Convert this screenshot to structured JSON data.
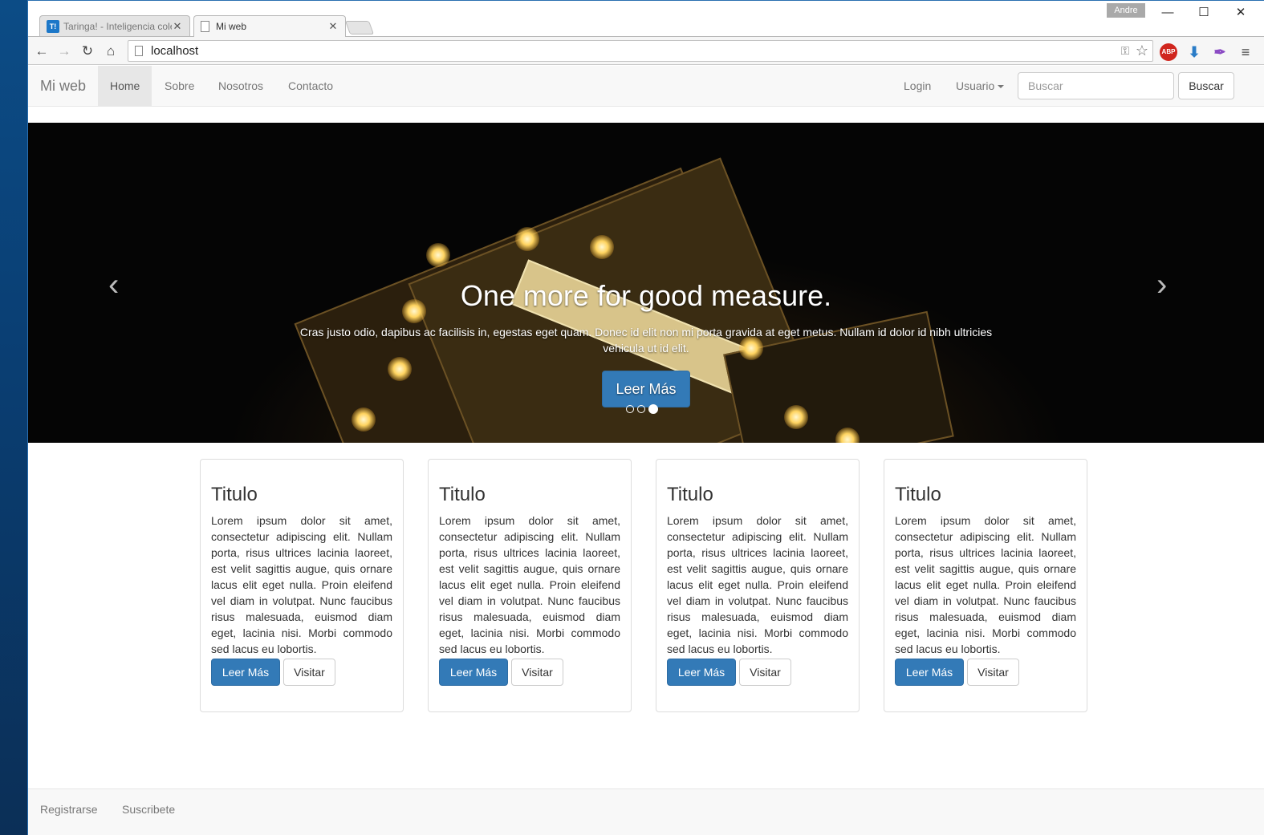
{
  "browser": {
    "tabs": [
      {
        "label": "Taringa! - Inteligencia cole",
        "favicon": "taringa-icon",
        "active": false
      },
      {
        "label": "Mi web",
        "favicon": "page-icon",
        "active": true
      }
    ],
    "profile": "Andre",
    "url": "localhost",
    "extensions": {
      "abp": "ABP"
    }
  },
  "navbar": {
    "brand": "Mi web",
    "items": [
      {
        "label": "Home",
        "active": true
      },
      {
        "label": "Sobre",
        "active": false
      },
      {
        "label": "Nosotros",
        "active": false
      },
      {
        "label": "Contacto",
        "active": false
      }
    ],
    "login": "Login",
    "user_menu": "Usuario",
    "search_placeholder": "Buscar",
    "search_button": "Buscar"
  },
  "carousel": {
    "heading": "One more for good measure.",
    "text": "Cras justo odio, dapibus ac facilisis in, egestas eget quam. Donec id elit non mi porta gravida at eget metus. Nullam id dolor id nibh ultricies vehicula ut id elit.",
    "button": "Leer Más",
    "slide_count": 3,
    "active_slide": 3
  },
  "cards": [
    {
      "title": "Titulo",
      "text": "Lorem ipsum dolor sit amet, consectetur adipiscing elit. Nullam porta, risus ultrices lacinia laoreet, est velit sagittis augue, quis ornare lacus elit eget nulla. Proin eleifend vel diam in volutpat. Nunc faucibus risus malesuada, euismod diam eget, lacinia nisi. Morbi commodo sed lacus eu lobortis.",
      "primary": "Leer Más",
      "secondary": "Visitar"
    },
    {
      "title": "Titulo",
      "text": "Lorem ipsum dolor sit amet, consectetur adipiscing elit. Nullam porta, risus ultrices lacinia laoreet, est velit sagittis augue, quis ornare lacus elit eget nulla. Proin eleifend vel diam in volutpat. Nunc faucibus risus malesuada, euismod diam eget, lacinia nisi. Morbi commodo sed lacus eu lobortis.",
      "primary": "Leer Más",
      "secondary": "Visitar"
    },
    {
      "title": "Titulo",
      "text": "Lorem ipsum dolor sit amet, consectetur adipiscing elit. Nullam porta, risus ultrices lacinia laoreet, est velit sagittis augue, quis ornare lacus elit eget nulla. Proin eleifend vel diam in volutpat. Nunc faucibus risus malesuada, euismod diam eget, lacinia nisi. Morbi commodo sed lacus eu lobortis.",
      "primary": "Leer Más",
      "secondary": "Visitar"
    },
    {
      "title": "Titulo",
      "text": "Lorem ipsum dolor sit amet, consectetur adipiscing elit. Nullam porta, risus ultrices lacinia laoreet, est velit sagittis augue, quis ornare lacus elit eget nulla. Proin eleifend vel diam in volutpat. Nunc faucibus risus malesuada, euismod diam eget, lacinia nisi. Morbi commodo sed lacus eu lobortis.",
      "primary": "Leer Más",
      "secondary": "Visitar"
    }
  ],
  "footer": {
    "links": [
      "Registrarse",
      "Suscribete"
    ]
  },
  "colors": {
    "primary": "#337ab7",
    "navbar_bg": "#f8f8f8",
    "navbar_text": "#777777"
  }
}
